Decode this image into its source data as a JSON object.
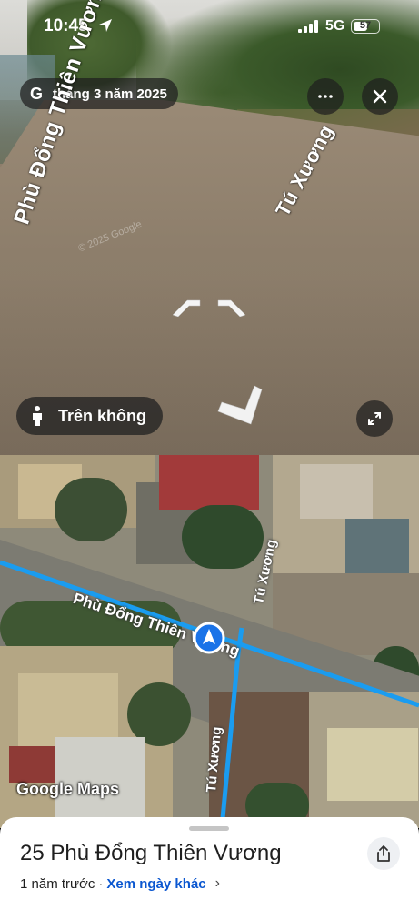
{
  "status_bar": {
    "time": "10:45",
    "network": "5G",
    "battery": "57",
    "battery_fraction": 0.57
  },
  "street_view": {
    "date_label": "tháng 3 năm 2025",
    "g_logo": "G",
    "road_label_main": "Phù Đổng Thiên Vương",
    "road_label_side": "Tú Xương",
    "copyright": "© 2025 Google",
    "aerial_button_label": "Trên không",
    "icons": {
      "more": "more-horizontal-icon",
      "close": "close-icon",
      "expand": "expand-icon",
      "aerial": "person-icon",
      "location_arrow": "location-arrow-icon"
    }
  },
  "map": {
    "road_label_main": "Phù Đổng Thiên Vương",
    "road_label_side_top": "Tú Xương",
    "road_label_side_bottom": "Tú Xương",
    "logo": "Google Maps",
    "road_color": "#1a9cf0",
    "marker_color": "#1a73e8"
  },
  "sheet": {
    "title": "25 Phù Đổng Thiên Vương",
    "time_ago": "1 năm trước",
    "separator": "·",
    "other_dates_link": "Xem ngày khác",
    "chevron": "›",
    "share_icon": "share-icon",
    "link_color": "#0b57d0"
  }
}
